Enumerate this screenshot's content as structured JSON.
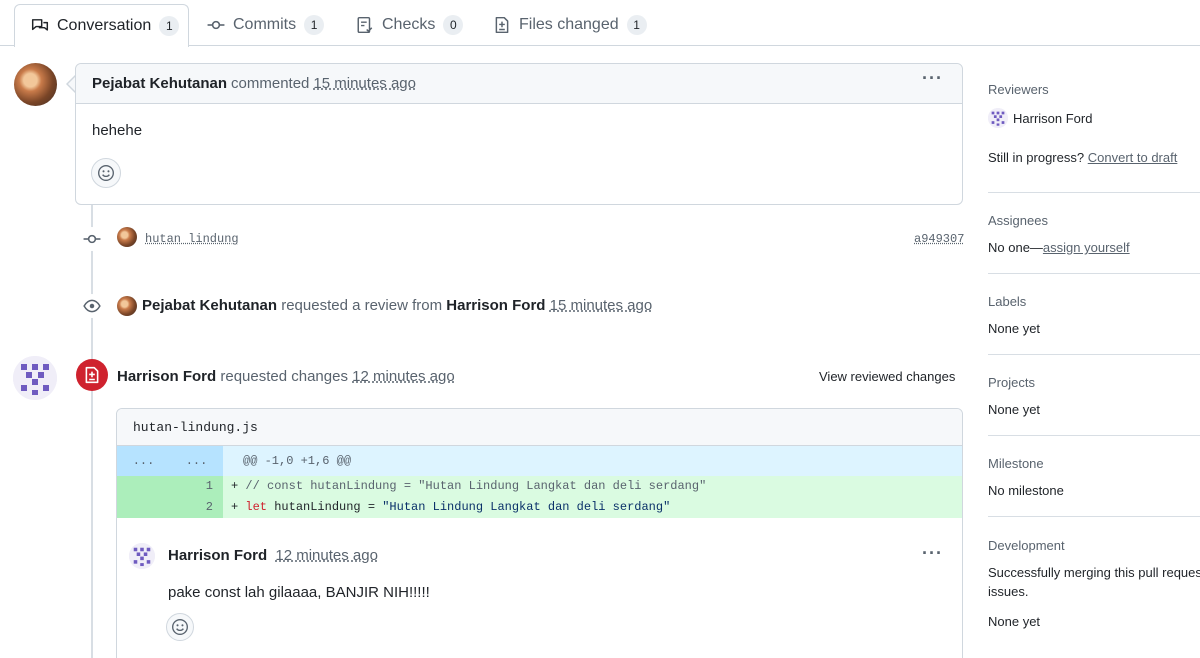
{
  "tabs": [
    {
      "label": "Conversation",
      "count": "1",
      "icon": "comment-discussion-icon"
    },
    {
      "label": "Commits",
      "count": "1",
      "icon": "commit-icon"
    },
    {
      "label": "Checks",
      "count": "0",
      "icon": "checklist-icon"
    },
    {
      "label": "Files changed",
      "count": "1",
      "icon": "file-diff-icon"
    }
  ],
  "comment": {
    "author": "Pejabat Kehutanan",
    "action": "commented",
    "time": "15 minutes ago",
    "body": "hehehe"
  },
  "commit": {
    "message": "hutan lindung",
    "sha": "a949307"
  },
  "review_request": {
    "author": "Pejabat Kehutanan",
    "action": "requested a review from",
    "reviewer": "Harrison Ford",
    "time": "15 minutes ago"
  },
  "review": {
    "author": "Harrison Ford",
    "action": "requested changes",
    "time": "12 minutes ago",
    "view_changes": "View reviewed changes"
  },
  "diff": {
    "filename": "hutan-lindung.js",
    "hunk_left": "...",
    "hunk_right": "...",
    "hunk_header": "@@ -1,0 +1,6 @@",
    "lines": [
      {
        "num": "1",
        "prefix": "+ ",
        "part1": "// const hutanLindung = \"Hutan Lindung Langkat dan deli serdang\"",
        "part2": "",
        "part3": ""
      },
      {
        "num": "2",
        "prefix": "+ ",
        "part1": "let",
        "part2": " hutanLindung = ",
        "part3": "\"Hutan Lindung Langkat dan deli serdang\""
      }
    ]
  },
  "reply": {
    "author": "Harrison Ford",
    "time": "12 minutes ago",
    "body": "pake const lah gilaaaa, BANJIR NIH!!!!!"
  },
  "sidebar": {
    "reviewers_title": "Reviewers",
    "reviewer_name": "Harrison Ford",
    "draft_prefix": "Still in progress?",
    "draft_link": "Convert to draft",
    "assignees_title": "Assignees",
    "assignees_none": "No one—",
    "assignees_link": "assign yourself",
    "labels_title": "Labels",
    "labels_value": "None yet",
    "projects_title": "Projects",
    "projects_value": "None yet",
    "milestone_title": "Milestone",
    "milestone_value": "No milestone",
    "development_title": "Development",
    "development_text1": "Successfully merging this pull request",
    "development_text2": "issues.",
    "development_value": "None yet"
  },
  "colors": {
    "request_changes_badge": "#cf222e",
    "added_line_bg": "#dafbe1",
    "hunk_bg": "#ddf4ff"
  }
}
